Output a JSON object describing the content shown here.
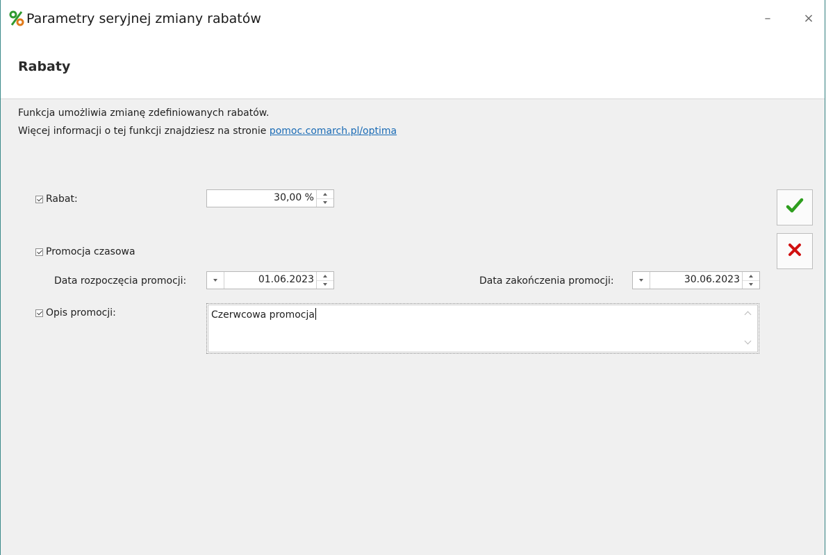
{
  "window": {
    "title": "Parametry seryjnej zmiany rabatów",
    "minimize_label": "–",
    "close_label": "×",
    "accent_color": "#3c8a8a"
  },
  "header": {
    "title": "Rabaty"
  },
  "info": {
    "line1": "Funkcja umożliwia zmianę zdefiniowanych rabatów.",
    "line2_prefix": "Więcej informacji o tej funkcji znajdziesz na stronie ",
    "link_text": "pomoc.comarch.pl/optima"
  },
  "form": {
    "rabat": {
      "label": "Rabat:",
      "checked": true,
      "value": "30,00 %"
    },
    "promocja": {
      "label": "Promocja czasowa",
      "checked": true
    },
    "start": {
      "label": "Data rozpoczęcia promocji:",
      "value": "01.06.2023"
    },
    "end": {
      "label": "Data zakończenia promocji:",
      "value": "30.06.2023"
    },
    "opis": {
      "label": "Opis promocji:",
      "checked": true,
      "value": "Czerwcowa promocja"
    }
  },
  "buttons": {
    "ok_icon": "green-checkmark-icon",
    "cancel_icon": "red-x-icon",
    "ok_color": "#2e9e1e",
    "cancel_color": "#d01010"
  }
}
